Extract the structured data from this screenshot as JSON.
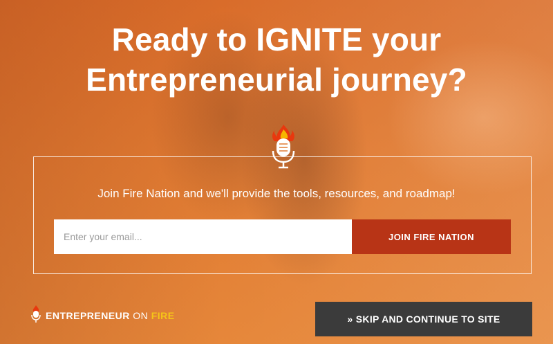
{
  "hero": {
    "headline_line1": "Ready to IGNITE your",
    "headline_line2": "Entrepreneurial journey?"
  },
  "signup": {
    "subtitle": "Join Fire Nation and we'll provide the tools, resources, and roadmap!",
    "email_placeholder": "Enter your email...",
    "join_label": "JOIN FIRE NATION"
  },
  "footer": {
    "logo_part1": "ENTREPRENEUR",
    "logo_part2": "ON",
    "logo_part3": "FIRE",
    "skip_label": "» SKIP AND CONTINUE TO SITE"
  },
  "icons": {
    "badge": "flaming-microphone-icon",
    "logo": "flaming-microphone-icon"
  },
  "colors": {
    "overlay_orange": "#e07a32",
    "join_button": "#b83416",
    "skip_button": "#3b3b3b",
    "logo_fire": "#f5c518"
  }
}
